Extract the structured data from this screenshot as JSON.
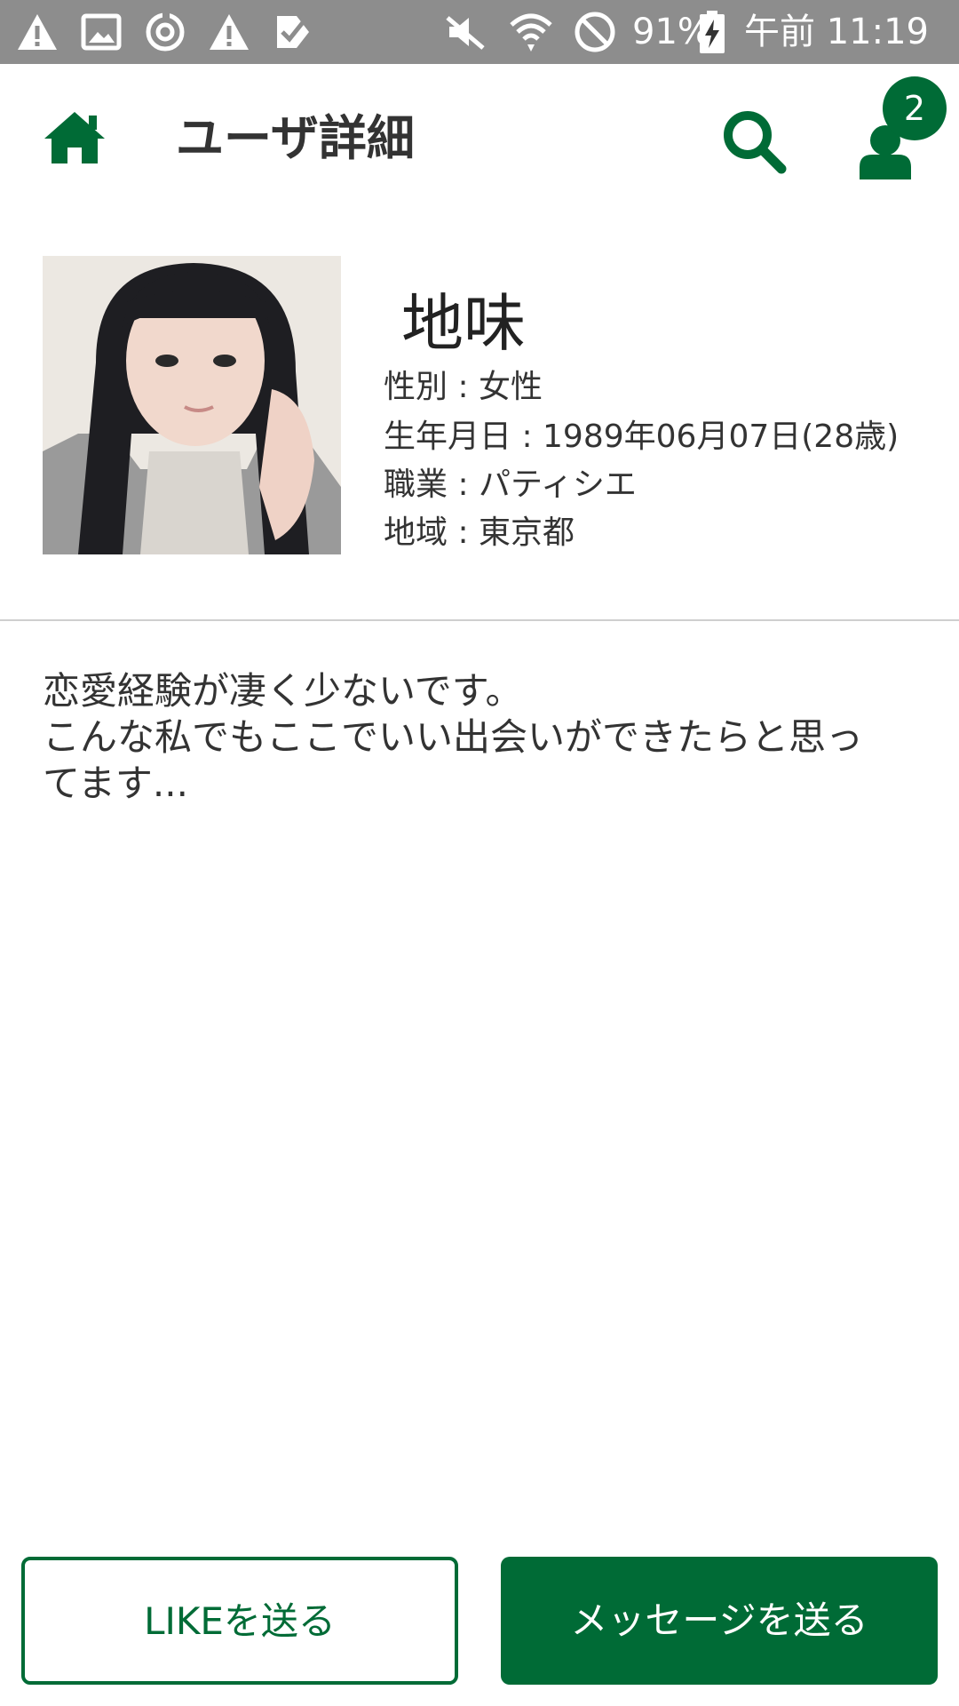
{
  "status_bar": {
    "battery": "91%",
    "time": "午前 11:19",
    "icons": [
      "warning-icon",
      "image-icon",
      "sync-icon",
      "warning-icon",
      "check-icon",
      "mute-icon",
      "wifi-icon",
      "do-not-disturb-icon",
      "battery-charging-icon"
    ]
  },
  "header": {
    "title": "ユーザ詳細",
    "badge_count": "2",
    "accent_color": "#006b36"
  },
  "profile": {
    "name": "地味",
    "gender": "性別 : 女性",
    "birthday": "生年月日 : 1989年06月07日(28歳)",
    "occupation": "職業 : パティシエ",
    "region": "地域 : 東京都"
  },
  "intro": {
    "lines": [
      "恋愛経験が凄く少ないです。",
      "こんな私でもここでいい出会いができたらと思っ",
      "てます..."
    ]
  },
  "actions": {
    "like_label": "LIKEを送る",
    "message_label": "メッセージを送る"
  }
}
